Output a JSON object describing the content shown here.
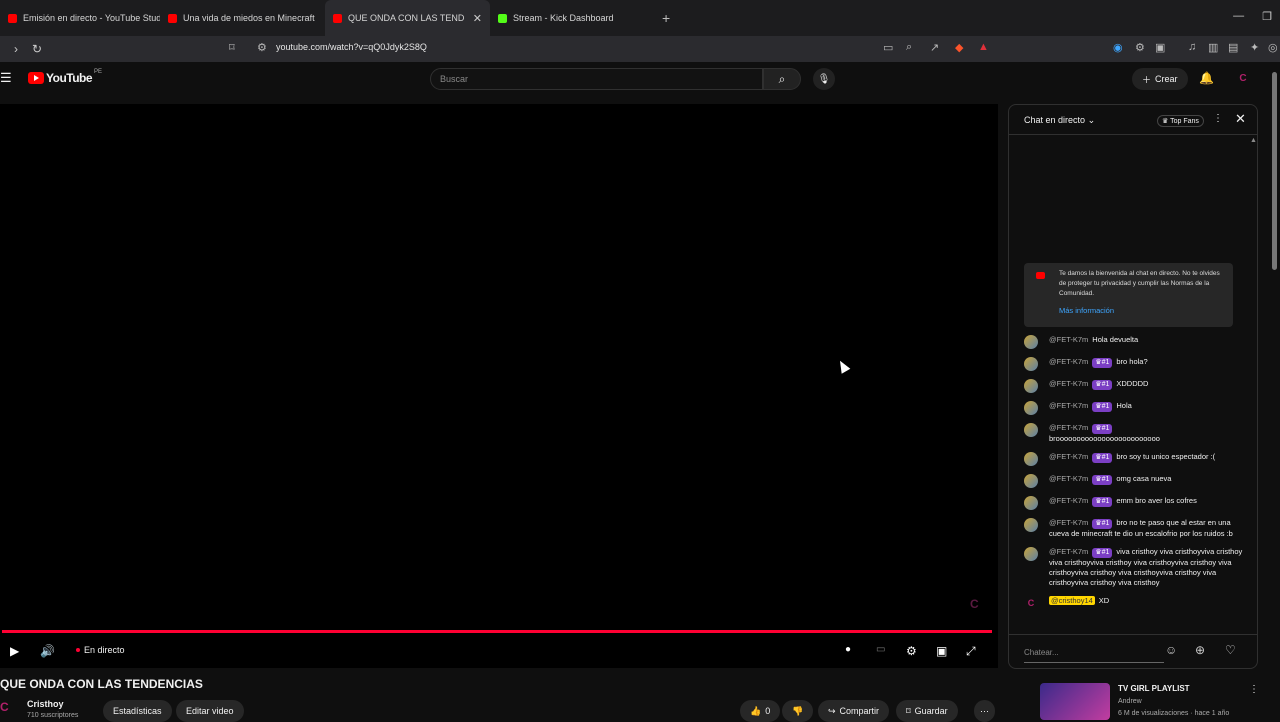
{
  "browser": {
    "tabs": [
      {
        "label": "Emisión en directo - YouTube Studio",
        "color": "#ff0000"
      },
      {
        "label": "Una vida de miedos en Minecraft",
        "color": "#ff0000"
      },
      {
        "label": "QUE ONDA CON LAS TENDENCIAS",
        "color": "#ff0000"
      },
      {
        "label": "Stream - Kick Dashboard",
        "color": "#53fc18"
      }
    ],
    "newtab": "+",
    "url": "youtube.com/watch?v=qQ0Jdyk2S8Q"
  },
  "yt": {
    "logo_text": "YouTube",
    "region": "PE",
    "search_placeholder": "Buscar",
    "create_label": "Crear"
  },
  "player": {
    "live_label": "En directo",
    "progress": 1.0
  },
  "video": {
    "title": "QUE ONDA CON LAS TENDENCIAS",
    "channel": "Cristhoy",
    "subs": "710 suscriptores",
    "stats_label": "Estadísticas",
    "edit_label": "Editar video",
    "likes": "0",
    "share_label": "Compartir",
    "save_label": "Guardar"
  },
  "chat": {
    "title": "Chat en directo",
    "top_fans": "Top Fans",
    "welcome": "Te damos la bienvenida al chat en directo. No te olvides de proteger tu privacidad y cumplir las Normas de la Comunidad.",
    "more_info": "Más información",
    "input_placeholder": "Chatear...",
    "messages": [
      {
        "author": "@FET-K7m",
        "badge": "",
        "text": "Hola devuelta"
      },
      {
        "author": "@FET-K7m",
        "badge": "#1",
        "text": "bro hola?"
      },
      {
        "author": "@FET-K7m",
        "badge": "#1",
        "text": "XDDDDD"
      },
      {
        "author": "@FET-K7m",
        "badge": "#1",
        "text": "Hola"
      },
      {
        "author": "@FET-K7m",
        "badge": "#1",
        "text": "brooooooooooooooooooooooooo"
      },
      {
        "author": "@FET-K7m",
        "badge": "#1",
        "text": "bro soy tu unico espectador :("
      },
      {
        "author": "@FET-K7m",
        "badge": "#1",
        "text": "omg casa nueva"
      },
      {
        "author": "@FET-K7m",
        "badge": "#1",
        "text": "emm bro aver los cofres"
      },
      {
        "author": "@FET-K7m",
        "badge": "#1",
        "text": "bro no te paso que al estar en una cueva de minecraft te dio un escalofrio por los ruidos :b"
      },
      {
        "author": "@FET-K7m",
        "badge": "#1",
        "text": "viva cristhoy viva cristhoyviva cristhoy viva cristhoyviva cristhoy viva cristhoyviva cristhoy viva cristhoyviva cristhoy viva cristhoyviva cristhoy viva cristhoyviva cristhoy viva cristhoy"
      }
    ],
    "owner_message": {
      "author": "@cristhoy14",
      "text": "XD"
    }
  },
  "recommended": {
    "title": "TV GIRL PLAYLIST",
    "channel": "Andrew",
    "meta": "6 M de visualizaciones · hace 1 año"
  }
}
